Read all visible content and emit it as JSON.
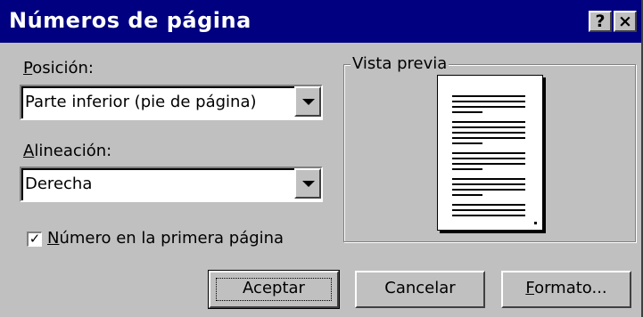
{
  "window": {
    "title": "Números de página",
    "help_glyph": "?",
    "close_glyph": "×"
  },
  "position": {
    "label_first": "P",
    "label_rest": "osición:",
    "value": "Parte inferior (pie de página)"
  },
  "alignment": {
    "label_first": "A",
    "label_rest": "lineación:",
    "value": "Derecha"
  },
  "first_page": {
    "checked": true,
    "check_glyph": "✓",
    "label_first": "N",
    "label_rest": "úmero en la primera página"
  },
  "preview": {
    "label": "Vista previa"
  },
  "buttons": {
    "accept": "Aceptar",
    "cancel": "Cancelar",
    "format_first": "F",
    "format_rest": "ormato..."
  },
  "colors": {
    "titlebar": "#000080",
    "face": "#c0c0c0"
  }
}
